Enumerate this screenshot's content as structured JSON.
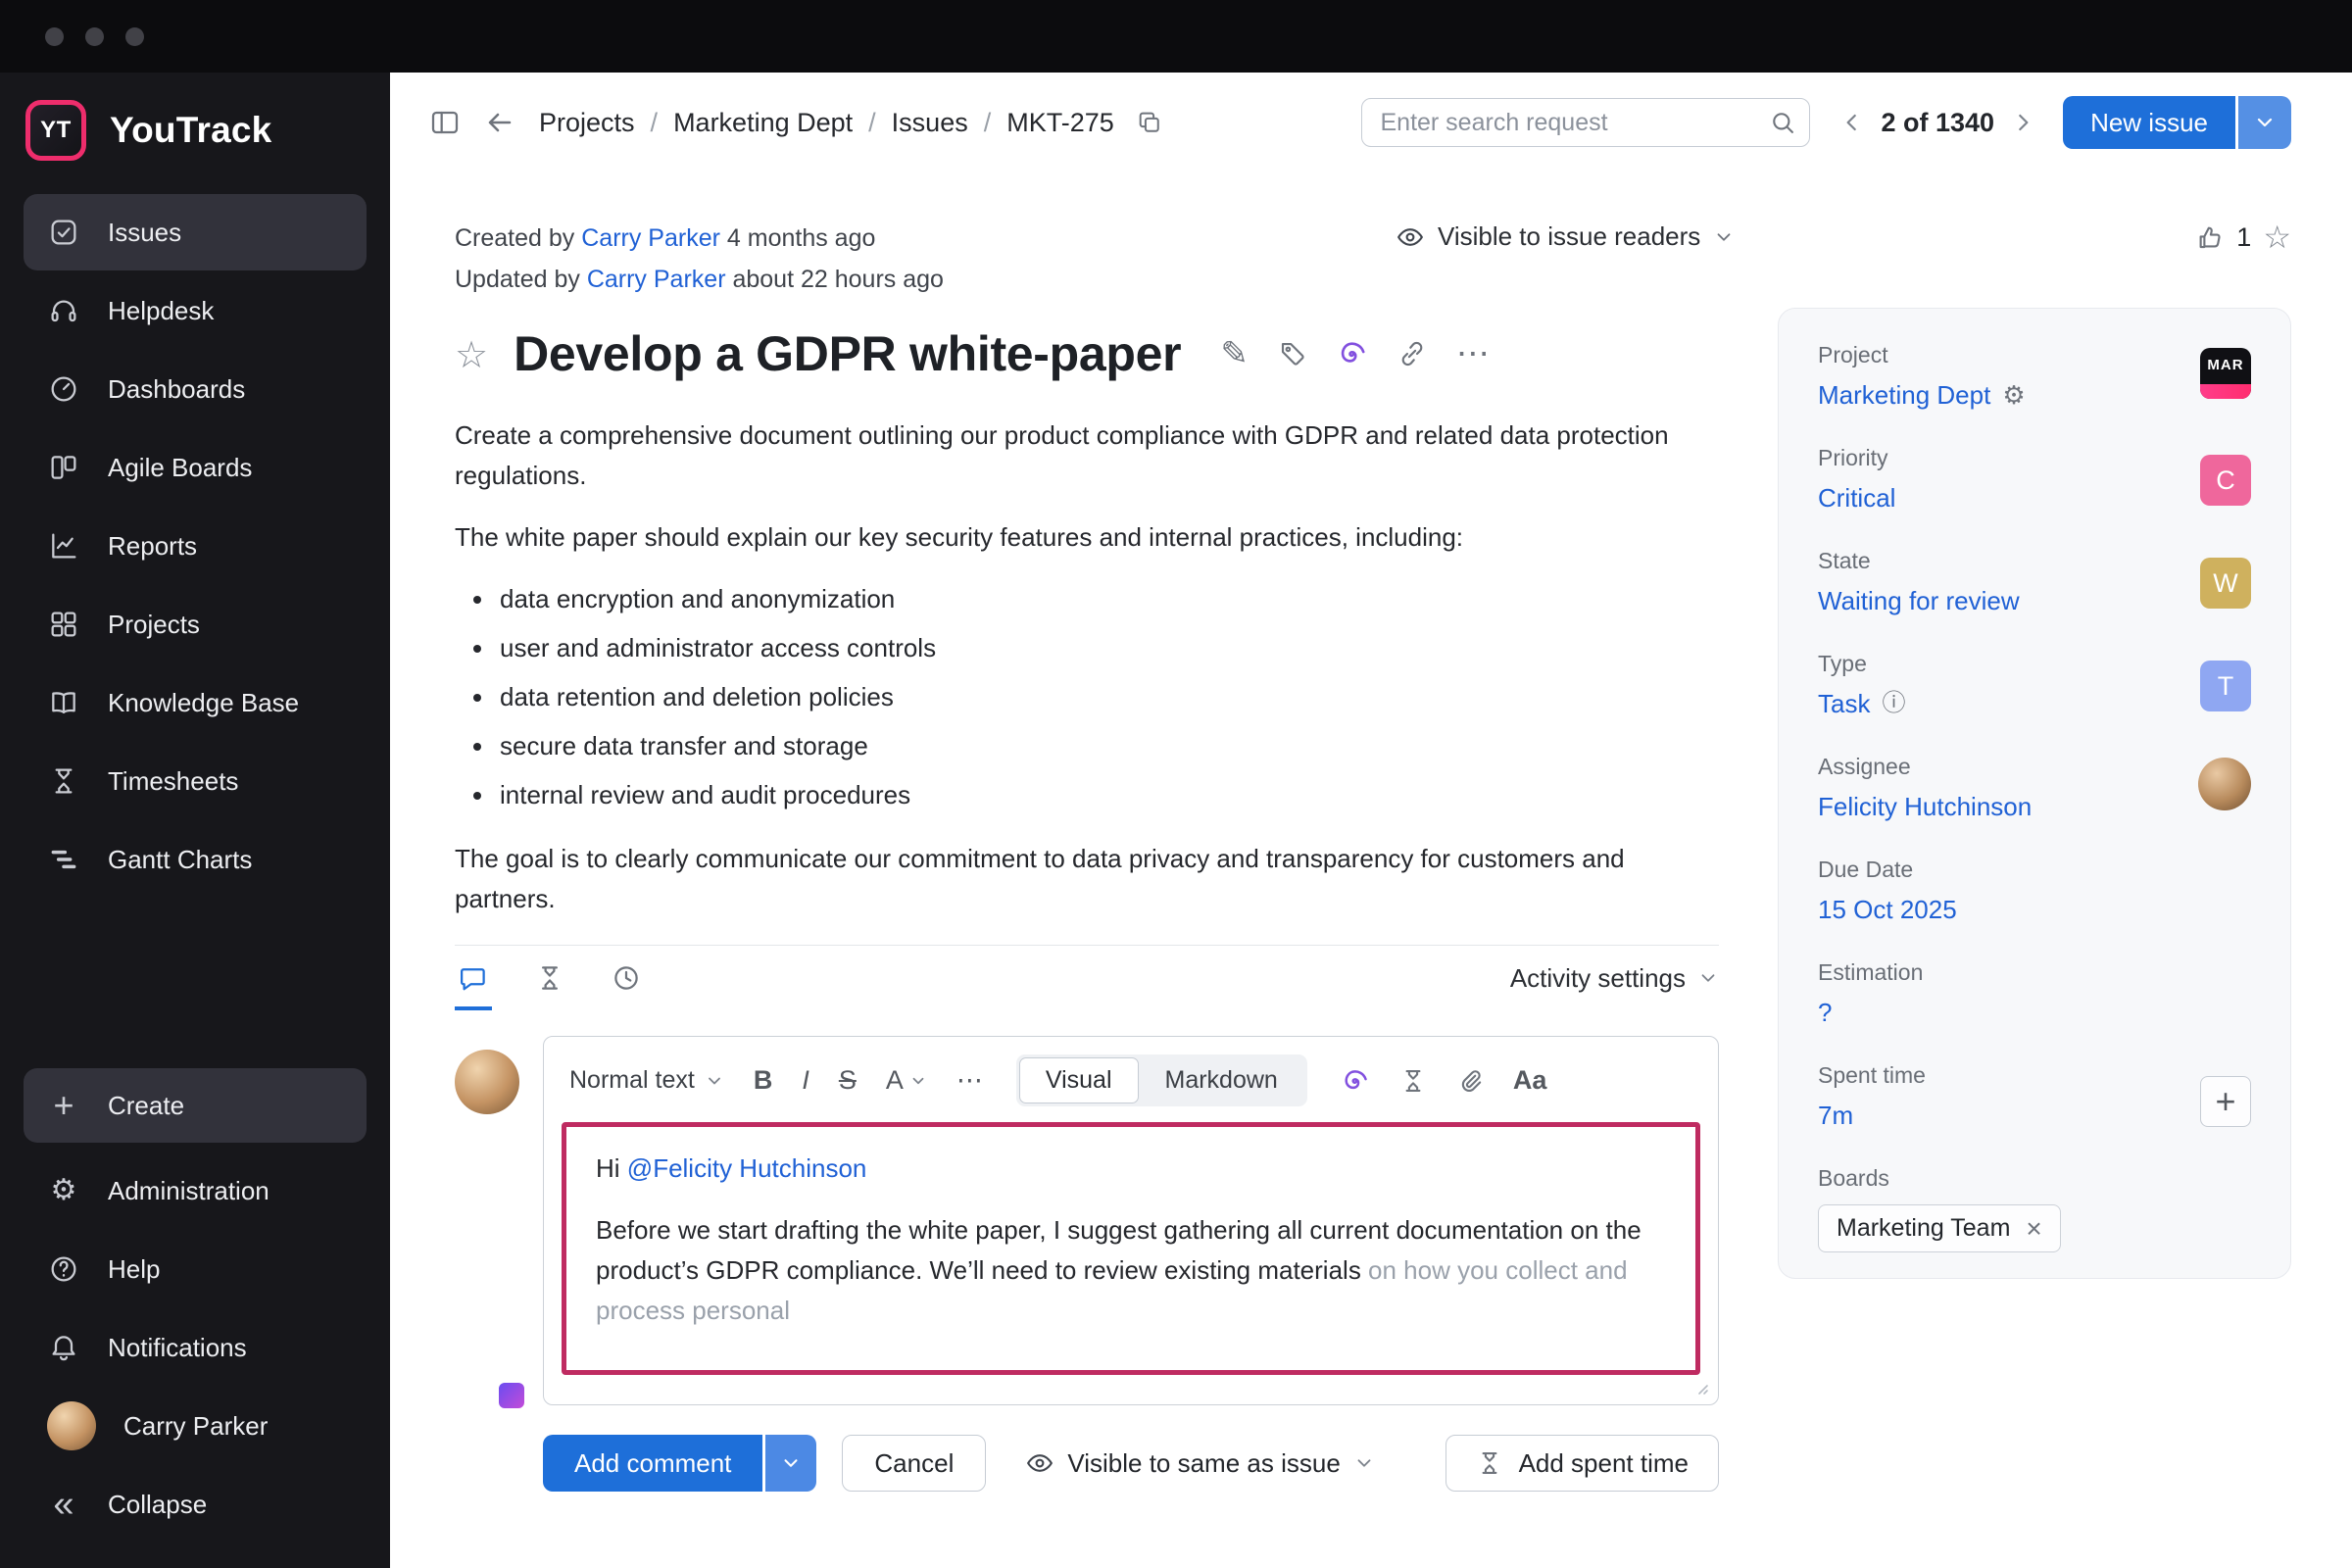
{
  "icons": {
    "collapse": "«",
    "gear": "⚙",
    "info": "ⓘ",
    "ellipsis": "⋯",
    "star_outline": "☆",
    "pencil": "✎",
    "plus": "+",
    "close": "×"
  },
  "colors": {
    "accent_blue": "#1e6fd9",
    "link_blue": "#2061d5",
    "highlight_pink": "#bf2b61",
    "ai_purple": "#8250df",
    "priority_badge": "#ef679c",
    "state_badge": "#cfb15e",
    "type_badge": "#8fa7f2"
  },
  "sidebar": {
    "app_name": "YouTrack",
    "logo_text": "YT",
    "items": [
      {
        "label": "Issues",
        "icon": "issues-icon"
      },
      {
        "label": "Helpdesk",
        "icon": "headset-icon"
      },
      {
        "label": "Dashboards",
        "icon": "gauge-icon"
      },
      {
        "label": "Agile Boards",
        "icon": "board-columns-icon"
      },
      {
        "label": "Reports",
        "icon": "chart-icon"
      },
      {
        "label": "Projects",
        "icon": "grid-icon"
      },
      {
        "label": "Knowledge Base",
        "icon": "book-icon"
      },
      {
        "label": "Timesheets",
        "icon": "hourglass-icon"
      },
      {
        "label": "Gantt Charts",
        "icon": "gantt-icon"
      }
    ],
    "create_label": "Create",
    "bottom_items": [
      {
        "label": "Administration",
        "icon": "gear-icon"
      },
      {
        "label": "Help",
        "icon": "help-icon"
      },
      {
        "label": "Notifications",
        "icon": "bell-icon"
      },
      {
        "label": "Carry Parker",
        "icon": "user-avatar"
      },
      {
        "label": "Collapse",
        "icon": "collapse-icon"
      }
    ]
  },
  "header": {
    "separator": "/",
    "breadcrumb": {
      "projects": "Projects",
      "project": "Marketing Dept",
      "issues": "Issues",
      "issue_id": "MKT-275"
    },
    "search_placeholder": "Enter search request",
    "pagination": "2 of 1340",
    "new_issue_label": "New issue"
  },
  "meta": {
    "created_prefix": "Created by",
    "created_author": "Carry Parker",
    "created_time": "4 months ago",
    "updated_prefix": "Updated by",
    "updated_author": "Carry Parker",
    "updated_time": "about 22 hours ago",
    "visibility_label": "Visible to issue readers",
    "stars_count": "1"
  },
  "issue": {
    "title": "Develop a GDPR white-paper",
    "description": {
      "p1": "Create a comprehensive document outlining our product compliance with GDPR and related data protection regulations.",
      "p2": "The white paper should explain our key security features and internal practices, including:",
      "bullets": [
        "data encryption and anonymization",
        "user and administrator access controls",
        "data retention and deletion policies",
        "secure data transfer and storage",
        "internal review and audit procedures"
      ],
      "p3": "The goal is to clearly communicate our commitment to data privacy and transparency for customers and partners."
    }
  },
  "activity": {
    "settings_label": "Activity settings"
  },
  "editor": {
    "paragraph_style": "Normal text",
    "bold": "B",
    "italic": "I",
    "strike": "S",
    "color": "A",
    "visual_label": "Visual",
    "markdown_label": "Markdown",
    "fontcase_label": "Aa",
    "comment": {
      "greeting": "Hi",
      "mention": "@Felicity Hutchinson",
      "body": "Before we start drafting the white paper, I suggest gathering all current documentation on the product’s GDPR compliance. We’ll need to review existing materials",
      "ghost": " on how you collect and process personal"
    },
    "add_comment_label": "Add comment",
    "cancel_label": "Cancel",
    "visibility_label": "Visible to same as issue",
    "add_spent_time_label": "Add spent time"
  },
  "fields": {
    "project": {
      "label": "Project",
      "value": "Marketing Dept",
      "avatar_text": "MAR"
    },
    "priority": {
      "label": "Priority",
      "value": "Critical",
      "badge": "C"
    },
    "state": {
      "label": "State",
      "value": "Waiting for review",
      "badge": "W"
    },
    "type": {
      "label": "Type",
      "value": "Task",
      "badge": "T"
    },
    "assignee": {
      "label": "Assignee",
      "value": "Felicity Hutchinson"
    },
    "due_date": {
      "label": "Due Date",
      "value": "15 Oct 2025"
    },
    "estimation": {
      "label": "Estimation",
      "value": "?"
    },
    "spent_time": {
      "label": "Spent time",
      "value": "7m"
    },
    "boards": {
      "label": "Boards",
      "chip": "Marketing Team"
    }
  }
}
